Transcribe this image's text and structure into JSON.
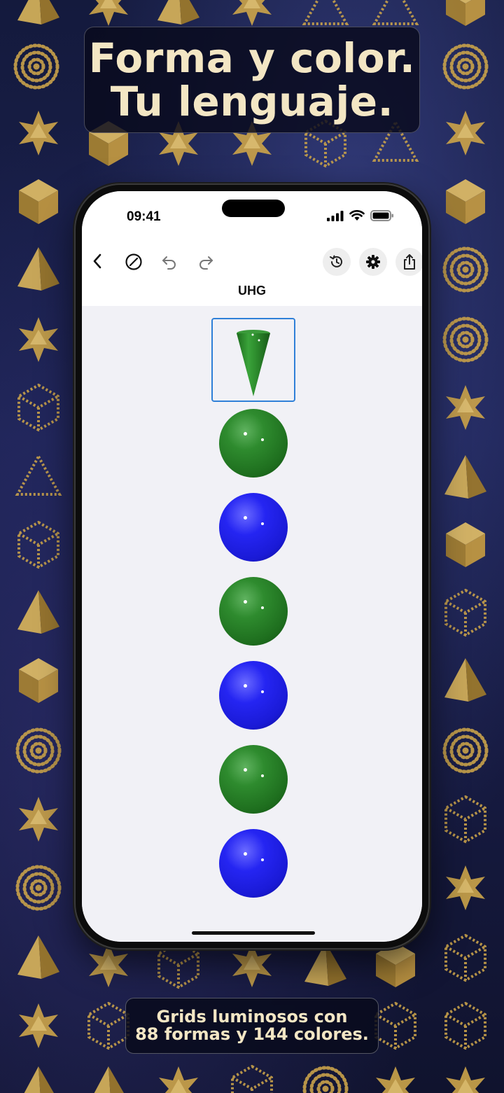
{
  "headline": {
    "line1": "Forma y color.",
    "line2": "Tu lenguaje."
  },
  "status_bar": {
    "time": "09:41",
    "icons": [
      "cellular-signal-icon",
      "wifi-icon",
      "battery-icon"
    ]
  },
  "toolbar": {
    "icons": [
      "back-chevron-icon",
      "clear-slash-icon",
      "undo-icon",
      "redo-icon",
      "history-icon",
      "gear-icon",
      "share-icon"
    ]
  },
  "document": {
    "title": "UHG"
  },
  "grid": {
    "cells": [
      {
        "shape": "cone",
        "color": "green",
        "selected": true
      },
      {
        "shape": "sphere",
        "color": "green",
        "selected": false
      },
      {
        "shape": "sphere",
        "color": "blue",
        "selected": false
      },
      {
        "shape": "sphere",
        "color": "green",
        "selected": false
      },
      {
        "shape": "sphere",
        "color": "blue",
        "selected": false
      },
      {
        "shape": "sphere",
        "color": "green",
        "selected": false
      },
      {
        "shape": "sphere",
        "color": "blue",
        "selected": false
      }
    ]
  },
  "colors": {
    "headline_text": "#f3e6c4",
    "selection_border": "#2f80d8",
    "green_shape": "#2e8b2e",
    "blue_shape": "#2525f2",
    "gold_pattern": "#c9a24a"
  },
  "caption": {
    "line1": "Grids luminosos con",
    "line2": "88 formas y 144 colores."
  }
}
